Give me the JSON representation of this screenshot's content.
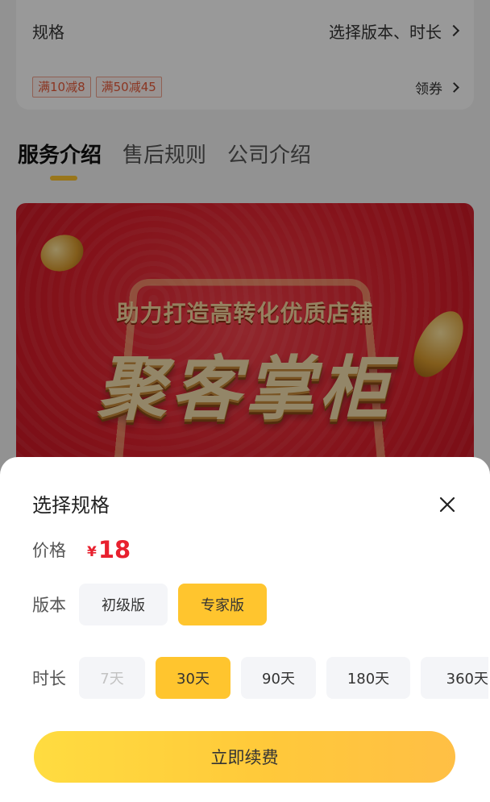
{
  "spec": {
    "label": "规格",
    "value": "选择版本、时长",
    "coupons": [
      "满10减8",
      "满50减45"
    ],
    "coupon_link": "领券"
  },
  "tabs": [
    {
      "label": "服务介绍",
      "active": true
    },
    {
      "label": "售后规则",
      "active": false
    },
    {
      "label": "公司介绍",
      "active": false
    }
  ],
  "banner": {
    "subtitle": "助力打造高转化优质店铺",
    "title": "聚客掌柜"
  },
  "sheet": {
    "title": "选择规格",
    "close_icon": "close-icon",
    "price_label": "价格",
    "price_symbol": "¥",
    "price_value": "18",
    "version_label": "版本",
    "versions": [
      {
        "label": "初级版",
        "selected": false
      },
      {
        "label": "专家版",
        "selected": true
      }
    ],
    "duration_label": "时长",
    "durations": [
      {
        "label": "7天",
        "selected": false,
        "disabled": true
      },
      {
        "label": "30天",
        "selected": true,
        "disabled": false
      },
      {
        "label": "90天",
        "selected": false,
        "disabled": false
      },
      {
        "label": "180天",
        "selected": false,
        "disabled": false
      },
      {
        "label": "360天",
        "selected": false,
        "disabled": false
      }
    ],
    "renew_button": "立即续费"
  },
  "colors": {
    "accent": "#ffc52e",
    "price": "#e8202e",
    "coupon": "#e85a3a"
  }
}
